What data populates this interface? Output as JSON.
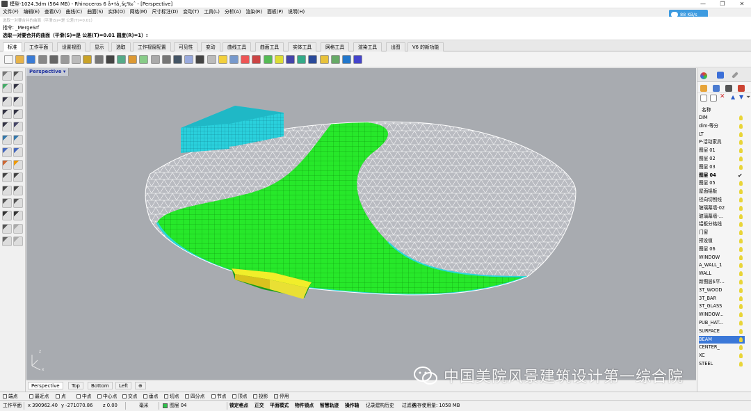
{
  "window": {
    "title": "模型-1024.3dm (564 MB) - Rhinoceros 6 å•†ä¸šç‰ˆ - [Perspective]",
    "min_glyph": "—",
    "restore_glyph": "❐",
    "close_glyph": "✕"
  },
  "net_widget": {
    "text": "88 KB/s"
  },
  "menu": [
    "文件(F)",
    "编辑(E)",
    "查看(V)",
    "曲线(C)",
    "曲面(S)",
    "实体(O)",
    "网格(M)",
    "尺寸标注(D)",
    "变动(T)",
    "工具(L)",
    "分析(A)",
    "渲染(R)",
    "面板(P)",
    "说明(H)"
  ],
  "command": {
    "history": "选取一对要合并的曲面（平滑(S)=是 公差(T)=0.01）",
    "prompt": "指令: _MergeSrf",
    "options": "选取一对要合并的曲面（平滑(S)=是 公差(T)=0.01 圆度(R)=1）:"
  },
  "tabs": [
    "标准",
    "工作平面",
    "设置视图",
    "显示",
    "选取",
    "工作视窗配置",
    "可见性",
    "变动",
    "曲线工具",
    "曲面工具",
    "实体工具",
    "网格工具",
    "渲染工具",
    "出图",
    "V6 的新功能"
  ],
  "viewport": {
    "label": "Perspective",
    "menu_glyph": "▾",
    "axis_z": "z",
    "axis_x": "x"
  },
  "viewport_tabs": [
    "Perspective",
    "Top",
    "Bottom",
    "Left"
  ],
  "viewport_tab_add": "⊕",
  "layers_panel": {
    "header": "名称",
    "layers": [
      {
        "name": "DIM"
      },
      {
        "name": "dim-等分"
      },
      {
        "name": "LT"
      },
      {
        "name": "P-活动家具"
      },
      {
        "name": "图层 01"
      },
      {
        "name": "图层 02"
      },
      {
        "name": "图层 03"
      },
      {
        "name": "图层 04",
        "current": true
      },
      {
        "name": "图层 05"
      },
      {
        "name": "屋面铝板"
      },
      {
        "name": "径向切割线"
      },
      {
        "name": "玻璃幕墙-02"
      },
      {
        "name": "玻璃幕墙-..."
      },
      {
        "name": "铝板分格线"
      },
      {
        "name": "门窗"
      },
      {
        "name": "预设值"
      },
      {
        "name": "图层 06"
      },
      {
        "name": "WINDOW"
      },
      {
        "name": "A_WALL_1"
      },
      {
        "name": "WALL"
      },
      {
        "name": "新图层$平..."
      },
      {
        "name": "3T_WOOD"
      },
      {
        "name": "3T_BAR"
      },
      {
        "name": "3T_GLASS"
      },
      {
        "name": "WINDOW..."
      },
      {
        "name": "PUB_HAT..."
      },
      {
        "name": "SURFACE"
      },
      {
        "name": "BEAM",
        "selected": true
      },
      {
        "name": "CENTER_"
      },
      {
        "name": "XC"
      },
      {
        "name": "STEEL"
      }
    ],
    "check_glyph": "✔"
  },
  "osnap": [
    "端点",
    "最近点",
    "点",
    "中点",
    "中心点",
    "交点",
    "垂点",
    "切点",
    "四分点",
    "节点",
    "顶点",
    "投影",
    "停用"
  ],
  "status": {
    "cplane": "工作平面",
    "x": "x 390962.40",
    "y": "y -271070.86",
    "z": "z 0.00",
    "units": "毫米",
    "layer": "图层 04",
    "items": [
      "锁定格点",
      "正交",
      "平面模式",
      "物件锁点",
      "智慧轨迹",
      "操作轴",
      "记录建构历史",
      "过滤器"
    ],
    "memory": "内存使用量: 1058 MB"
  },
  "watermark": "中国美院风景建筑设计第一综合院"
}
